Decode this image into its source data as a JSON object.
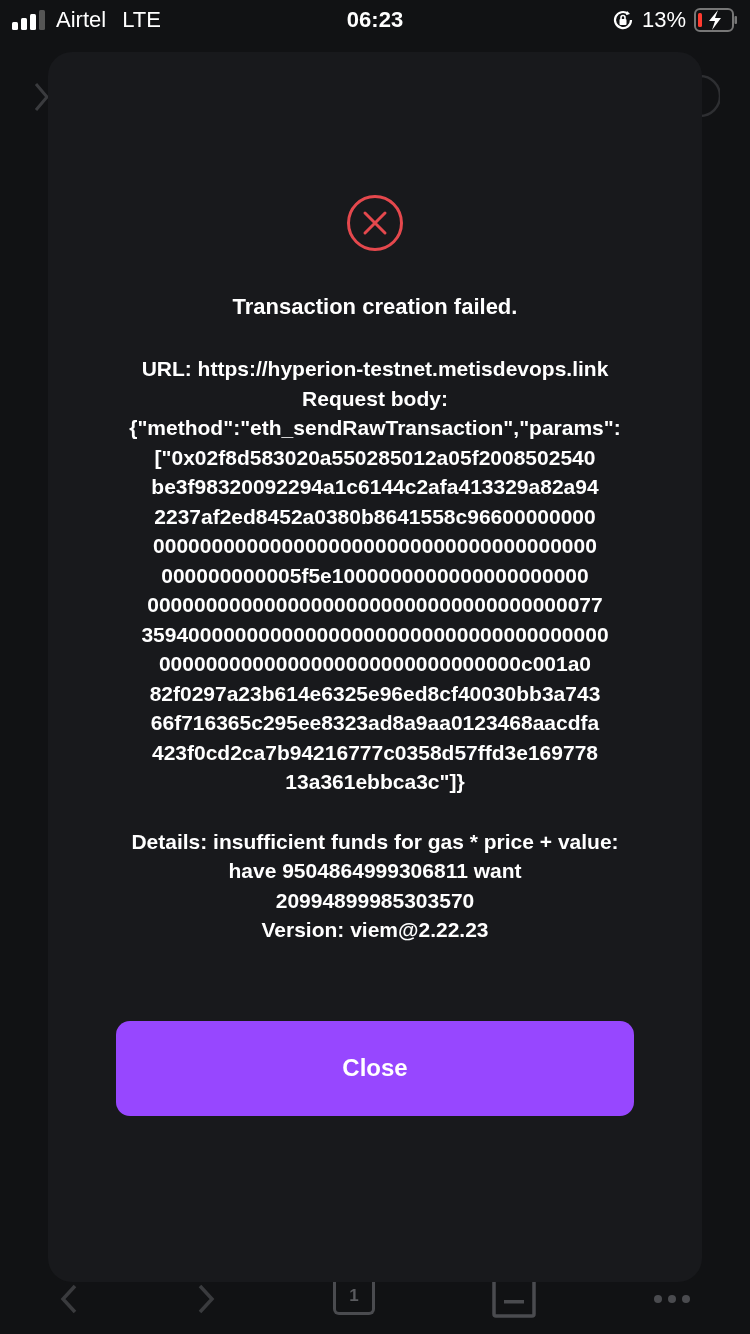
{
  "status_bar": {
    "carrier": "Airtel",
    "network": "LTE",
    "time": "06:23",
    "battery_percent": "13%"
  },
  "toolbar": {
    "tab_count": "1"
  },
  "dialog": {
    "title": "Transaction creation failed.",
    "request_lines": [
      "URL: https://hyperion-testnet.metisdevops.link",
      "Request body:",
      "{\"method\":\"eth_sendRawTransaction\",\"params\":",
      "[\"0x02f8d583020a550285012a05f2008502540",
      "be3f98320092294a1c6144c2afa413329a82a94",
      "2237af2ed8452a0380b8641558c96600000000",
      "00000000000000000000000000000000000000",
      "000000000005f5e1000000000000000000000",
      "000000000000000000000000000000000000077",
      "3594000000000000000000000000000000000000",
      "0000000000000000000000000000000c001a0",
      "82f0297a23b614e6325e96ed8cf40030bb3a743",
      "66f716365c295ee8323ad8a9aa0123468aacdfa",
      "423f0cd2ca7b94216777c0358d57ffd3e169778",
      "13a361ebbca3c\"]}"
    ],
    "detail_lines": [
      "Details: insufficient funds for gas * price + value:",
      "have 9504864999306811 want",
      "20994899985303570",
      "Version: viem@2.22.23"
    ],
    "button": "Close"
  }
}
